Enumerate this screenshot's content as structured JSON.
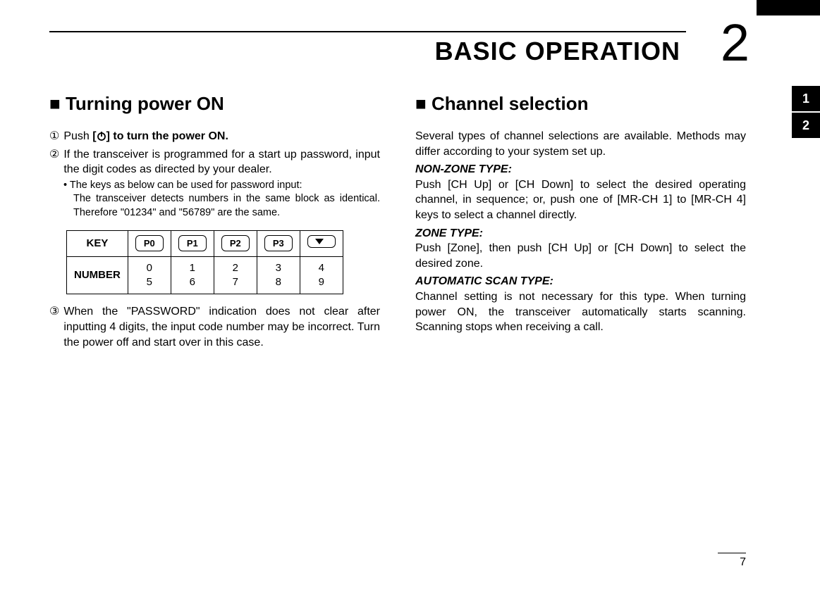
{
  "header": {
    "chapter_title": "BASIC OPERATION",
    "chapter_number": "2"
  },
  "side_tabs": [
    "1",
    "2"
  ],
  "left_column": {
    "section_title": "Turning power ON",
    "step1_pre": "Push ",
    "step1_mid": "[",
    "step1_post": "] to turn the power ON.",
    "step2": "If the transceiver is programmed for a start up password, input the digit codes as directed by your dealer.",
    "note_bullet": "• The keys as below can be used for password input:",
    "note_detail": "The transceiver detects numbers in the same block as identical. Therefore \"01234\" and \"56789\" are the same.",
    "table": {
      "row1_label": "KEY",
      "keys": [
        "P0",
        "P1",
        "P2",
        "P3",
        "▼"
      ],
      "row2_label": "NUMBER",
      "numbers_top": [
        "0",
        "1",
        "2",
        "3",
        "4"
      ],
      "numbers_bottom": [
        "5",
        "6",
        "7",
        "8",
        "9"
      ]
    },
    "step3": "When the \"PASSWORD\" indication does not clear after inputting 4 digits, the input code number may be incorrect. Turn the power off and start over in this case."
  },
  "right_column": {
    "section_title": "Channel selection",
    "intro": "Several types of channel selections are available. Methods may differ according to your system set up.",
    "nonzone_heading": "NON-ZONE TYPE:",
    "nonzone_body": "Push [CH Up] or [CH Down] to select the desired operating channel, in sequence; or, push one of [MR-CH 1] to [MR-CH 4] keys to select a channel directly.",
    "zone_heading": "ZONE TYPE:",
    "zone_body": "Push [Zone], then push [CH Up] or [CH Down] to select the desired zone.",
    "auto_heading": "AUTOMATIC SCAN TYPE:",
    "auto_body": "Channel setting is not necessary for this type. When turning power ON, the transceiver automatically starts scanning. Scanning stops when receiving a call."
  },
  "footer": {
    "page_number": "7"
  }
}
